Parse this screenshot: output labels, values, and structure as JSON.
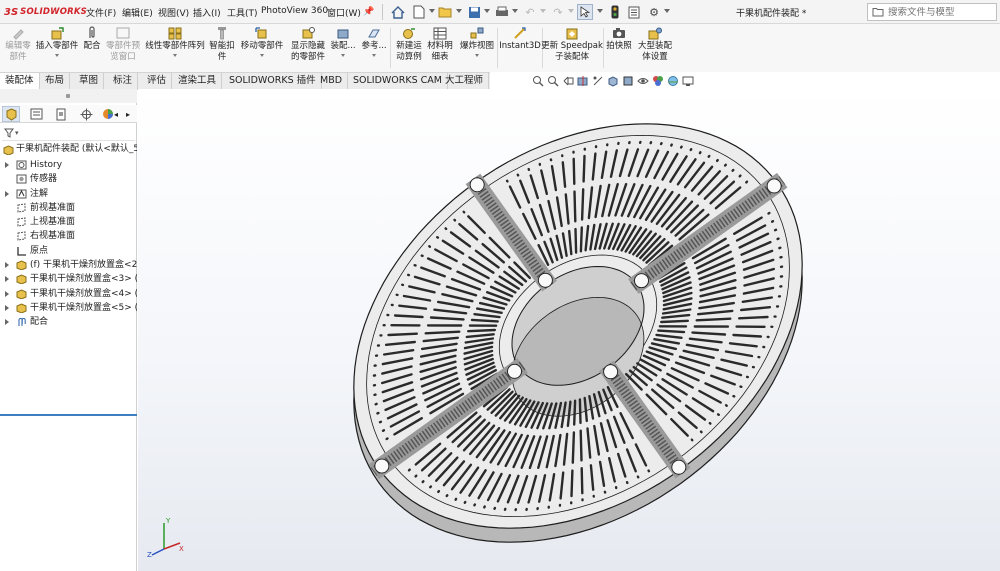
{
  "app": {
    "logo_ds": "3S",
    "logo_text": "SOLIDWORKS",
    "document_title": "干果机配件装配 *",
    "brand_color": "#d2232a"
  },
  "menu": [
    "文件(F)",
    "编辑(E)",
    "视图(V)",
    "插入(I)",
    "工具(T)",
    "PhotoView 360",
    "窗口(W)"
  ],
  "search": {
    "placeholder": "搜索文件与模型"
  },
  "command_manager": {
    "edit_component": "编辑零\n部件",
    "insert_component": "插入零部件",
    "mate": "配合",
    "component_preview": "零部件预\n览窗口",
    "linear_pattern": "线性零部件阵列",
    "smart_fasteners": "智能扣\n件",
    "move_component": "移动零部件",
    "show_hidden": "显示隐藏\n的零部件",
    "assembly_features": "装配...",
    "reference_geometry": "参考...",
    "new_motion_study": "新建运\n动算例",
    "bom": "材料明\n细表",
    "exploded_view": "爆炸视图",
    "instant3d": "Instant3D",
    "speedpak": "更新 Speedpak\n子装配体",
    "snapshot": "拍快照",
    "large_assembly": "大型装配\n体设置"
  },
  "tabs": [
    "装配体",
    "布局",
    "草图",
    "标注",
    "评估",
    "渲染工具",
    "SOLIDWORKS 插件",
    "MBD",
    "SOLIDWORKS CAM",
    "大工程师"
  ],
  "active_tab": "装配体",
  "feature_tree": {
    "root": "干果机配件装配  (默认<默认_5",
    "items": [
      {
        "label": "History",
        "expandable": true,
        "icon": "history-icon"
      },
      {
        "label": "传感器",
        "expandable": false,
        "icon": "sensor-icon"
      },
      {
        "label": "注解",
        "expandable": true,
        "icon": "annotation-icon"
      },
      {
        "label": "前视基准面",
        "expandable": false,
        "icon": "plane-icon"
      },
      {
        "label": "上视基准面",
        "expandable": false,
        "icon": "plane-icon"
      },
      {
        "label": "右视基准面",
        "expandable": false,
        "icon": "plane-icon"
      },
      {
        "label": "原点",
        "expandable": false,
        "icon": "origin-icon"
      },
      {
        "label": "(f) 干果机干燥剂放置盒<2>",
        "expandable": true,
        "icon": "part-icon"
      },
      {
        "label": "干果机干燥剂放置盒<3> (",
        "expandable": true,
        "icon": "part-icon"
      },
      {
        "label": "干果机干燥剂放置盒<4> (",
        "expandable": true,
        "icon": "part-icon"
      },
      {
        "label": "干果机干燥剂放置盒<5> (",
        "expandable": true,
        "icon": "part-icon"
      },
      {
        "label": "配合",
        "expandable": true,
        "icon": "mates-icon"
      }
    ]
  },
  "triad": {
    "x": "X",
    "y": "Y",
    "z": "Z"
  },
  "colors": {
    "model_face": "#ececec",
    "model_edge": "#1e1e1e",
    "model_wall": "#b8b8b8",
    "tab_active": "#ffffff",
    "selection": "#3d7fc1"
  }
}
